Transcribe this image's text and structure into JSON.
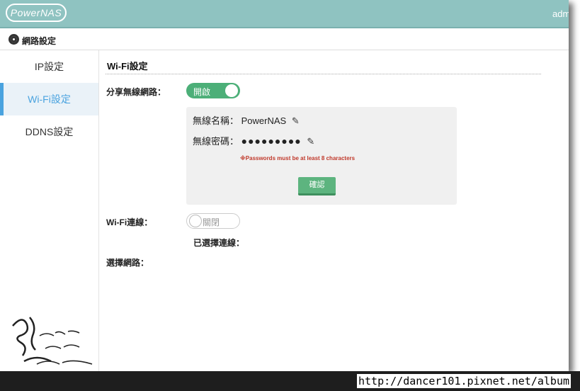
{
  "header": {
    "logo_text": "PowerNAS",
    "user_text": "adm"
  },
  "breadcrumb": {
    "icon": "network-globe-icon",
    "text": "網路設定"
  },
  "sidebar": {
    "items": [
      {
        "label": "IP設定",
        "active": false
      },
      {
        "label": "Wi-Fi設定",
        "active": true
      },
      {
        "label": "DDNS設定",
        "active": false
      }
    ]
  },
  "main": {
    "title": "Wi-Fi設定",
    "share_wireless": {
      "label": "分享無線網路：",
      "toggle_label": "開啟",
      "state": "on"
    },
    "panel": {
      "ssid_label": "無線名稱：",
      "ssid_value": "PowerNAS",
      "password_label": "無線密碼：",
      "password_value": "●●●●●●●●●",
      "warning": "※Passwords must be at least 8 characters",
      "confirm_label": "確認"
    },
    "wifi_connect": {
      "label": "Wi-Fi連線：",
      "toggle_label": "關閉",
      "state": "off",
      "selected_label": "已選擇連線："
    },
    "select_network_label": "選擇網路："
  },
  "footer": {
    "url": "http://dancer101.pixnet.net/album"
  },
  "colors": {
    "header_bg": "#8fc3c1",
    "active_accent": "#4aa3df",
    "toggle_on": "#4caf78",
    "warning": "#c0392b"
  }
}
